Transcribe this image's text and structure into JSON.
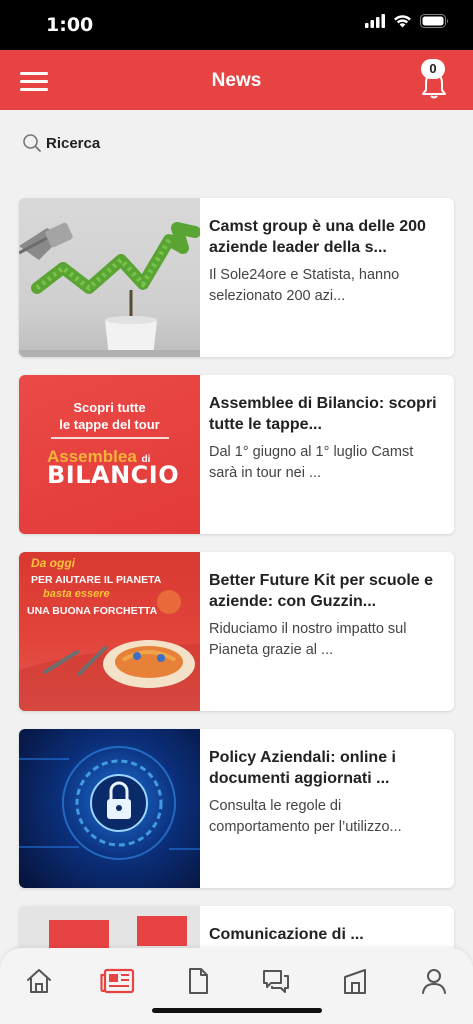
{
  "status": {
    "time": "1:00"
  },
  "header": {
    "title": "News",
    "notifications": "0"
  },
  "search": {
    "label": "Ricerca"
  },
  "articles": [
    {
      "title": "Camst group è una delle 200 aziende leader della s...",
      "excerpt": "Il Sole24ore e Statista, hanno selezionato 200 azi..."
    },
    {
      "title": "Assemblee di Bilancio: scopri tutte le tappe...",
      "excerpt": "Dal 1° giugno al 1° luglio Camst sarà in tour nei ...",
      "thumb_line1": "Scopri tutte",
      "thumb_line2": "le tappe del tour",
      "thumb_word1": "Assemblea",
      "thumb_word2": "di",
      "thumb_word3": "BILANCIO"
    },
    {
      "title": "Better Future Kit per scuole e aziende: con Guzzin...",
      "excerpt": "Riduciamo il nostro impatto sul Pianeta grazie al ...",
      "thumb_line1": "Da oggi",
      "thumb_line2": "PER AIUTARE IL PIANETA",
      "thumb_line3": "basta essere",
      "thumb_line4": "UNA BUONA FORCHETTA"
    },
    {
      "title": "Policy Aziendali: online i documenti aggiornati ...",
      "excerpt": "Consulta le regole di comportamento per l’utilizzo..."
    },
    {
      "title": "Comunicazione di ...",
      "excerpt": ""
    }
  ],
  "nav": [
    "home-icon",
    "news-icon",
    "document-icon",
    "chat-icon",
    "building-icon",
    "profile-icon"
  ],
  "colors": {
    "primary": "#e84343",
    "active_nav": "#e84343",
    "inactive_nav": "#555555"
  }
}
